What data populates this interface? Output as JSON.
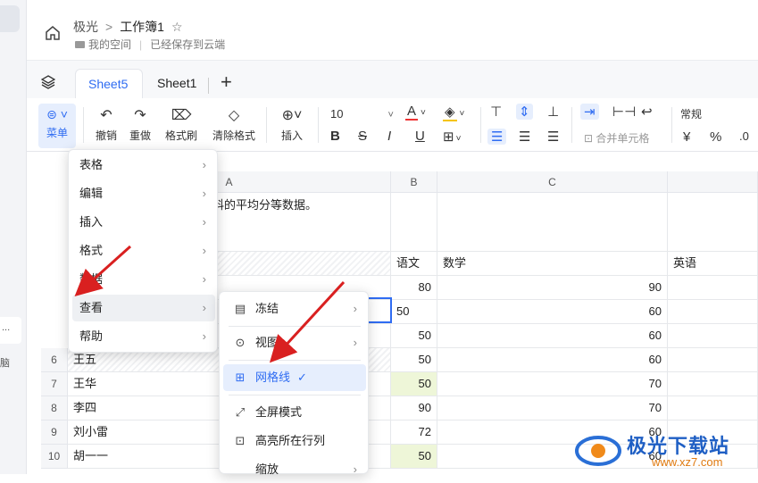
{
  "header": {
    "crumb_root": "极光",
    "crumb_sep": ">",
    "workbook": "工作簿1",
    "location": "我的空间",
    "save_status": "已经保存到云端"
  },
  "tabs": [
    {
      "label": "Sheet5"
    },
    {
      "label": "Sheet1"
    }
  ],
  "toolbar": {
    "menu": "菜单",
    "undo": "撤销",
    "redo": "重做",
    "format_painter": "格式刷",
    "clear_format": "清除格式",
    "insert": "插入",
    "font_size": "10",
    "merge": "合并单元格",
    "number_format": "常规",
    "currency": "¥",
    "percent": "%"
  },
  "columns": {
    "a": "A",
    "b": "B",
    "c": "C"
  },
  "sheet": {
    "intro": "计学科的平均分等数据。",
    "header_b": "语文",
    "header_c": "数学",
    "header_d": "英语",
    "rows": [
      {
        "n": "",
        "name": "",
        "b": "80",
        "c": "90"
      },
      {
        "n": "",
        "name": "",
        "b": "50",
        "c": "60"
      },
      {
        "n": "",
        "name": "",
        "b": "50",
        "c": "60"
      },
      {
        "n": "6",
        "name": "王五",
        "b": "50",
        "c": "60"
      },
      {
        "n": "7",
        "name": "王华",
        "b": "50",
        "c": "70"
      },
      {
        "n": "8",
        "name": "李四",
        "b": "90",
        "c": "70"
      },
      {
        "n": "9",
        "name": "刘小雷",
        "b": "72",
        "c": "60"
      },
      {
        "n": "10",
        "name": "胡一一",
        "b": "50",
        "c": "60"
      }
    ]
  },
  "menu": {
    "items": [
      "表格",
      "编辑",
      "插入",
      "格式",
      "数据",
      "查看",
      "帮助"
    ]
  },
  "submenu": {
    "items": [
      "冻结",
      "视图",
      "网格线",
      "全屏模式",
      "高亮所在行列",
      "缩放"
    ]
  },
  "watermark": {
    "brand": "极光下载站",
    "url": "www.xz7.com"
  },
  "left": {
    "dots": "...",
    "char": "脑"
  },
  "colors": {
    "accent": "#2f6cf2",
    "arrow": "#d92020",
    "highlight": "#eef6d8"
  }
}
